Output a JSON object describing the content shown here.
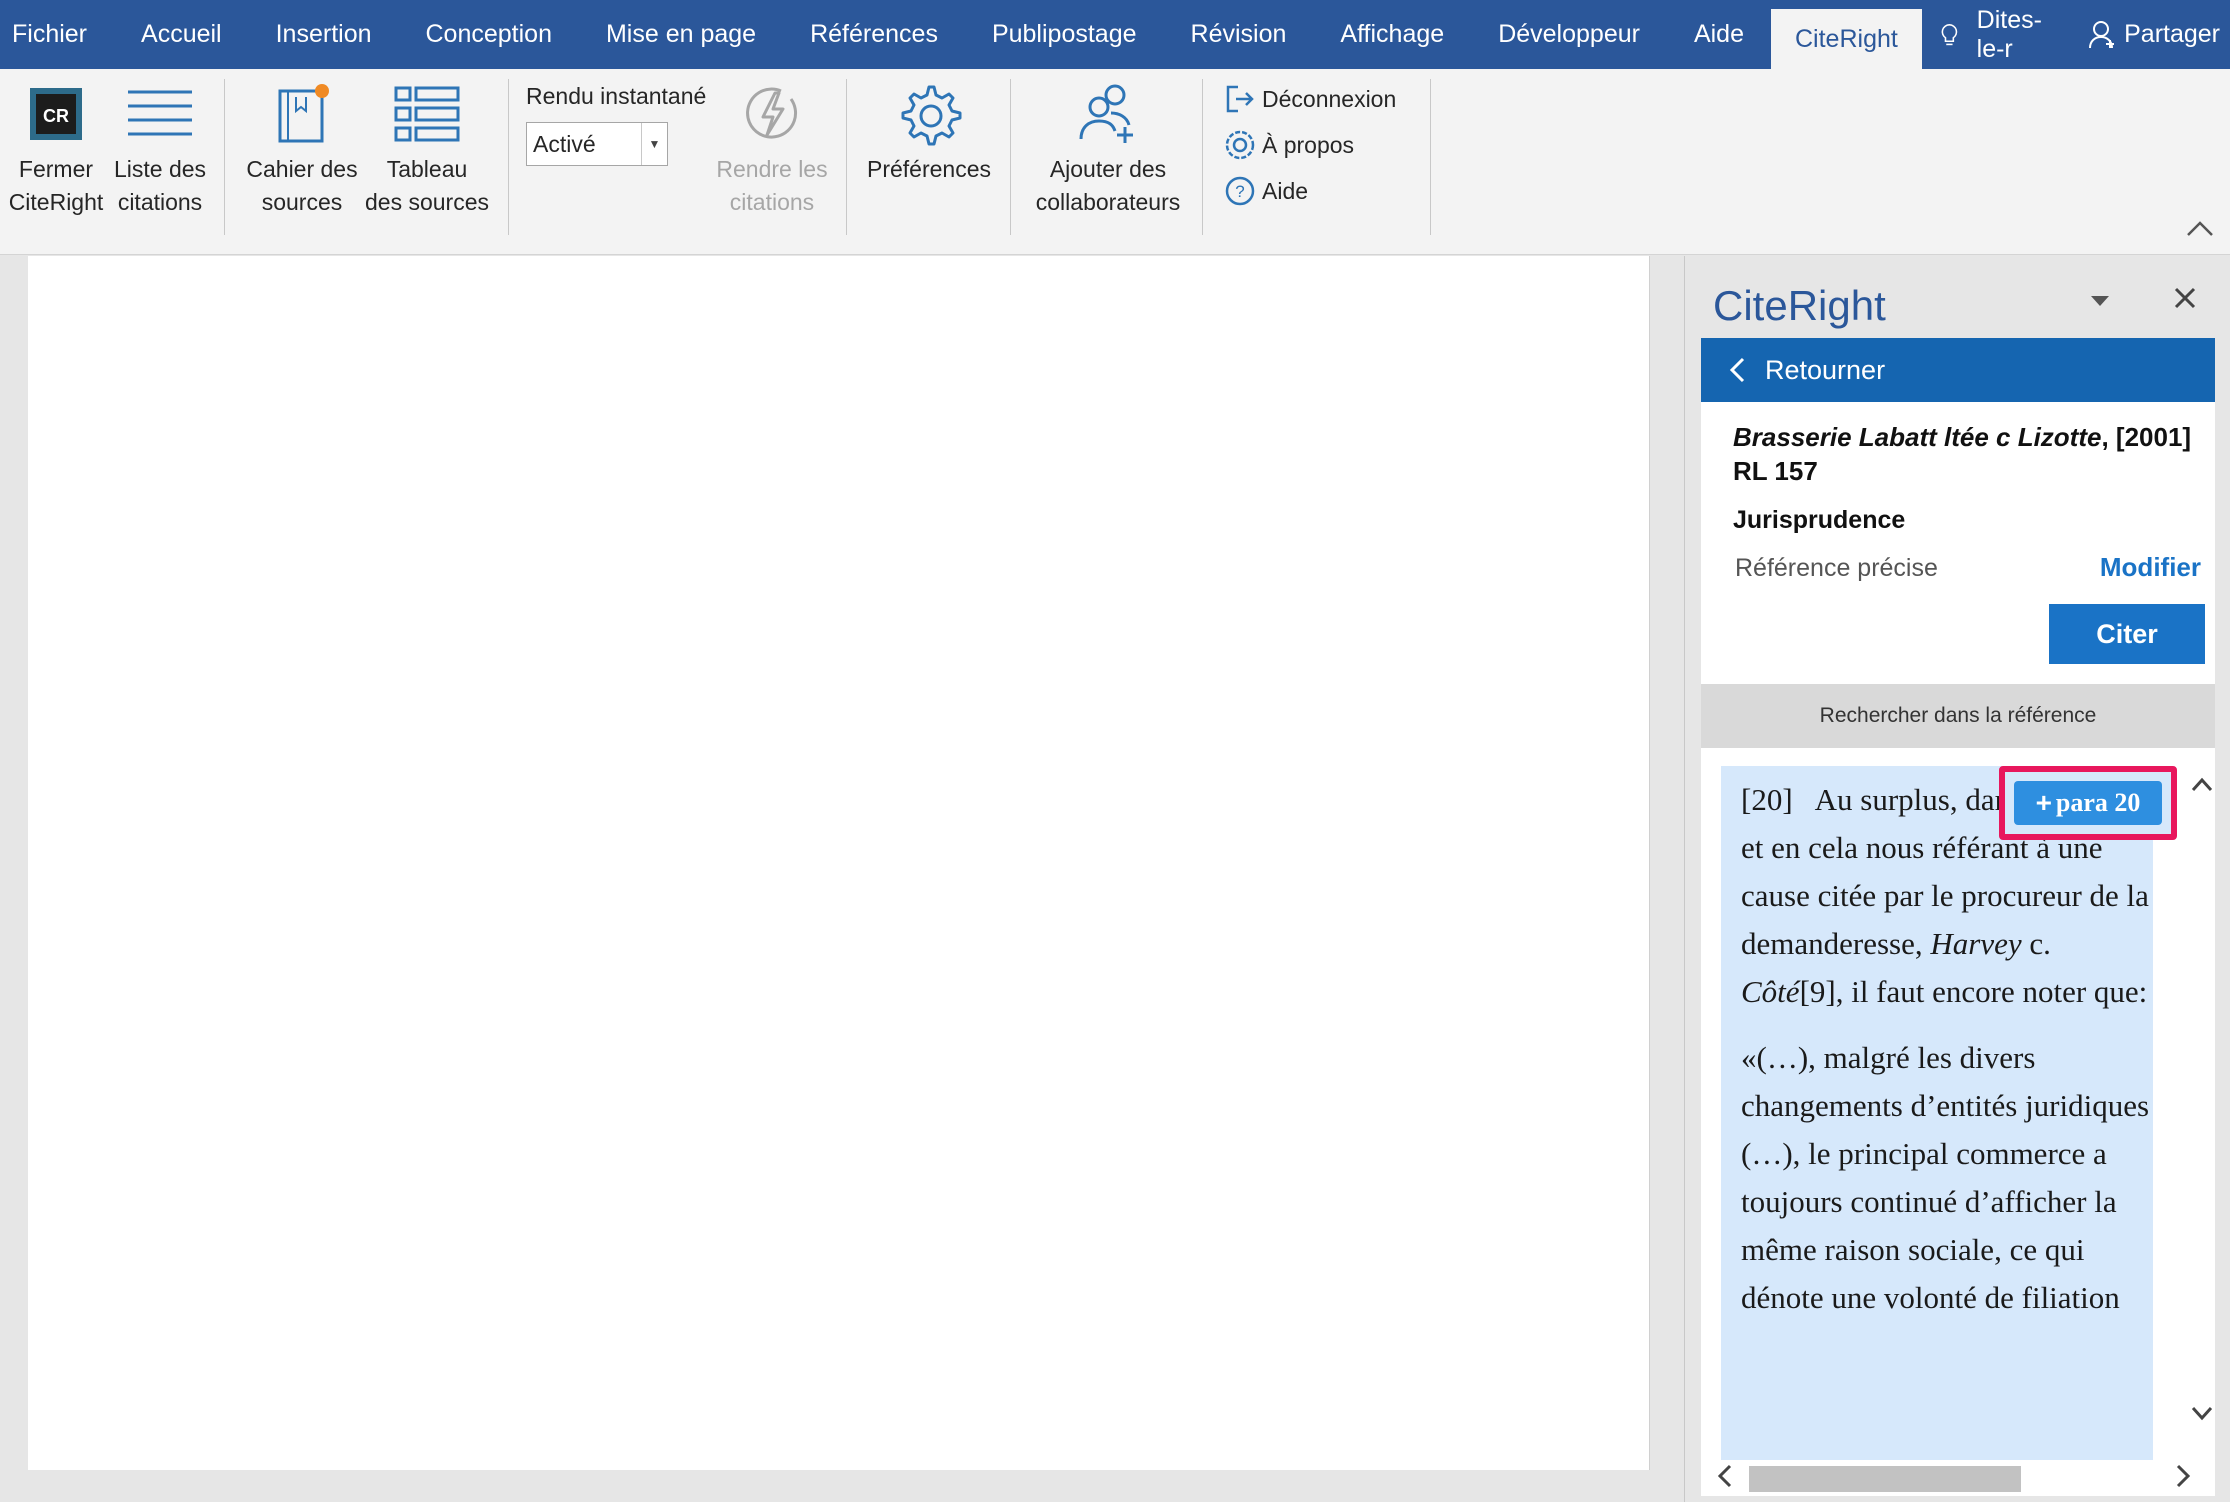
{
  "menubar": {
    "items": [
      "Fichier",
      "Accueil",
      "Insertion",
      "Conception",
      "Mise en page",
      "Références",
      "Publipostage",
      "Révision",
      "Affichage",
      "Développeur",
      "Aide",
      "CiteRight"
    ],
    "tell_me": "Dites-le-r",
    "share": "Partager"
  },
  "ribbon": {
    "close_citeright": "Fermer\nCiteRight",
    "citation_list": "Liste des\ncitations",
    "source_notebook": "Cahier des\nsources",
    "source_table": "Tableau\ndes sources",
    "instant_render_label": "Rendu instantané",
    "instant_render_value": "Activé",
    "render_citations": "Rendre les\ncitations",
    "preferences": "Préférences",
    "add_collaborators": "Ajouter des\ncollaborateurs",
    "logout": "Déconnexion",
    "about": "À propos",
    "help": "Aide",
    "logo_text": "CR"
  },
  "pane": {
    "title": "CiteRight",
    "back_label": "Retourner",
    "ref_case": "Brasserie Labatt ltée c Lizotte",
    "ref_citation": ", [2001] RL 157",
    "ref_type": "Jurisprudence",
    "precise_ref_label": "Référence précise",
    "modify_label": "Modifier",
    "cite_button": "Citer",
    "search_label": "Rechercher dans la référence",
    "para_badge": "para 20",
    "para_number": "[20]",
    "para1_a": "Au surplus, dans l’espèce, et en cela nous référant à une cause citée par le procureur de la demanderesse, ",
    "para1_case": "Harvey",
    "para1_b": " c. ",
    "para1_case2": "Côté",
    "para1_c": "[9], il faut encore noter que:",
    "para2": "«(…), malgré les divers changements d’entités juridiques (…), le principal commerce a toujours continué d’afficher la même raison sociale, ce qui dénote une volonté de filiation"
  },
  "colors": {
    "menubar_bg": "#2b579a",
    "accent_blue": "#1a73c6",
    "highlight_bg": "#d6e8fb",
    "badge_outline": "#e8175d"
  }
}
